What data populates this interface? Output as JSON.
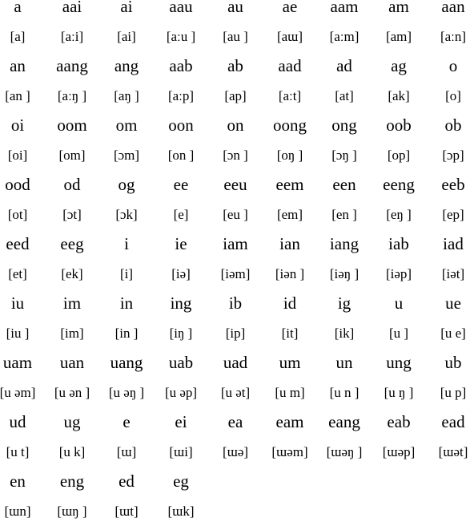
{
  "syllables": [
    {
      "spelling": "a",
      "ipa": "[a]"
    },
    {
      "spelling": "aai",
      "ipa": "[aːi]"
    },
    {
      "spelling": "ai",
      "ipa": "[ai]"
    },
    {
      "spelling": "aau",
      "ipa": "[aːu ]"
    },
    {
      "spelling": "au",
      "ipa": "[au ]"
    },
    {
      "spelling": "ae",
      "ipa": "[aɯ]"
    },
    {
      "spelling": "aam",
      "ipa": "[aːm]"
    },
    {
      "spelling": "am",
      "ipa": "[am]"
    },
    {
      "spelling": "aan",
      "ipa": "[aːn]"
    },
    {
      "spelling": "an",
      "ipa": "[an ]"
    },
    {
      "spelling": "aang",
      "ipa": "[aːŋ ]"
    },
    {
      "spelling": "ang",
      "ipa": "[aŋ ]"
    },
    {
      "spelling": "aab",
      "ipa": "[aːp]"
    },
    {
      "spelling": "ab",
      "ipa": "[ap]"
    },
    {
      "spelling": "aad",
      "ipa": "[aːt]"
    },
    {
      "spelling": "ad",
      "ipa": "[at]"
    },
    {
      "spelling": "ag",
      "ipa": "[ak]"
    },
    {
      "spelling": "o",
      "ipa": "[o]"
    },
    {
      "spelling": "oi",
      "ipa": "[oi]"
    },
    {
      "spelling": "oom",
      "ipa": "[om]"
    },
    {
      "spelling": "om",
      "ipa": "[ɔm]"
    },
    {
      "spelling": "oon",
      "ipa": "[on ]"
    },
    {
      "spelling": "on",
      "ipa": "[ɔn ]"
    },
    {
      "spelling": "oong",
      "ipa": "[oŋ ]"
    },
    {
      "spelling": "ong",
      "ipa": "[ɔŋ ]"
    },
    {
      "spelling": "oob",
      "ipa": "[op]"
    },
    {
      "spelling": "ob",
      "ipa": "[ɔp]"
    },
    {
      "spelling": "ood",
      "ipa": "[ot]"
    },
    {
      "spelling": "od",
      "ipa": "[ɔt]"
    },
    {
      "spelling": "og",
      "ipa": "[ɔk]"
    },
    {
      "spelling": "ee",
      "ipa": "[e]"
    },
    {
      "spelling": "eeu",
      "ipa": "[eu ]"
    },
    {
      "spelling": "eem",
      "ipa": "[em]"
    },
    {
      "spelling": "een",
      "ipa": "[en ]"
    },
    {
      "spelling": "eeng",
      "ipa": "[eŋ ]"
    },
    {
      "spelling": "eeb",
      "ipa": "[ep]"
    },
    {
      "spelling": "eed",
      "ipa": "[et]"
    },
    {
      "spelling": "eeg",
      "ipa": "[ek]"
    },
    {
      "spelling": "i",
      "ipa": "[i]"
    },
    {
      "spelling": "ie",
      "ipa": "[iə]"
    },
    {
      "spelling": "iam",
      "ipa": "[iəm]"
    },
    {
      "spelling": "ian",
      "ipa": "[iən ]"
    },
    {
      "spelling": "iang",
      "ipa": "[iəŋ ]"
    },
    {
      "spelling": "iab",
      "ipa": "[iəp]"
    },
    {
      "spelling": "iad",
      "ipa": "[iət]"
    },
    {
      "spelling": "iu",
      "ipa": "[iu ]"
    },
    {
      "spelling": "im",
      "ipa": "[im]"
    },
    {
      "spelling": "in",
      "ipa": "[in ]"
    },
    {
      "spelling": "ing",
      "ipa": "[iŋ ]"
    },
    {
      "spelling": "ib",
      "ipa": "[ip]"
    },
    {
      "spelling": "id",
      "ipa": "[it]"
    },
    {
      "spelling": "ig",
      "ipa": "[ik]"
    },
    {
      "spelling": "u",
      "ipa": "[u ]"
    },
    {
      "spelling": "ue",
      "ipa": "[u e]"
    },
    {
      "spelling": "uam",
      "ipa": "[u əm]"
    },
    {
      "spelling": "uan",
      "ipa": "[u ən ]"
    },
    {
      "spelling": "uang",
      "ipa": "[u əŋ ]"
    },
    {
      "spelling": "uab",
      "ipa": "[u əp]"
    },
    {
      "spelling": "uad",
      "ipa": "[u ət]"
    },
    {
      "spelling": "um",
      "ipa": "[u m]"
    },
    {
      "spelling": "un",
      "ipa": "[u n ]"
    },
    {
      "spelling": "ung",
      "ipa": "[u ŋ ]"
    },
    {
      "spelling": "ub",
      "ipa": "[u p]"
    },
    {
      "spelling": "ud",
      "ipa": "[u t]"
    },
    {
      "spelling": "ug",
      "ipa": "[u k]"
    },
    {
      "spelling": "e",
      "ipa": "[ɯ]"
    },
    {
      "spelling": "ei",
      "ipa": "[ɯi]"
    },
    {
      "spelling": "ea",
      "ipa": "[ɯə]"
    },
    {
      "spelling": "eam",
      "ipa": "[ɯəm]"
    },
    {
      "spelling": "eang",
      "ipa": "[ɯəŋ ]"
    },
    {
      "spelling": "eab",
      "ipa": "[ɯəp]"
    },
    {
      "spelling": "ead",
      "ipa": "[ɯət]"
    },
    {
      "spelling": "en",
      "ipa": "[ɯn]"
    },
    {
      "spelling": "eng",
      "ipa": "[ɯŋ ]"
    },
    {
      "spelling": "ed",
      "ipa": "[ɯt]"
    },
    {
      "spelling": "eg",
      "ipa": "[ɯk]"
    }
  ]
}
